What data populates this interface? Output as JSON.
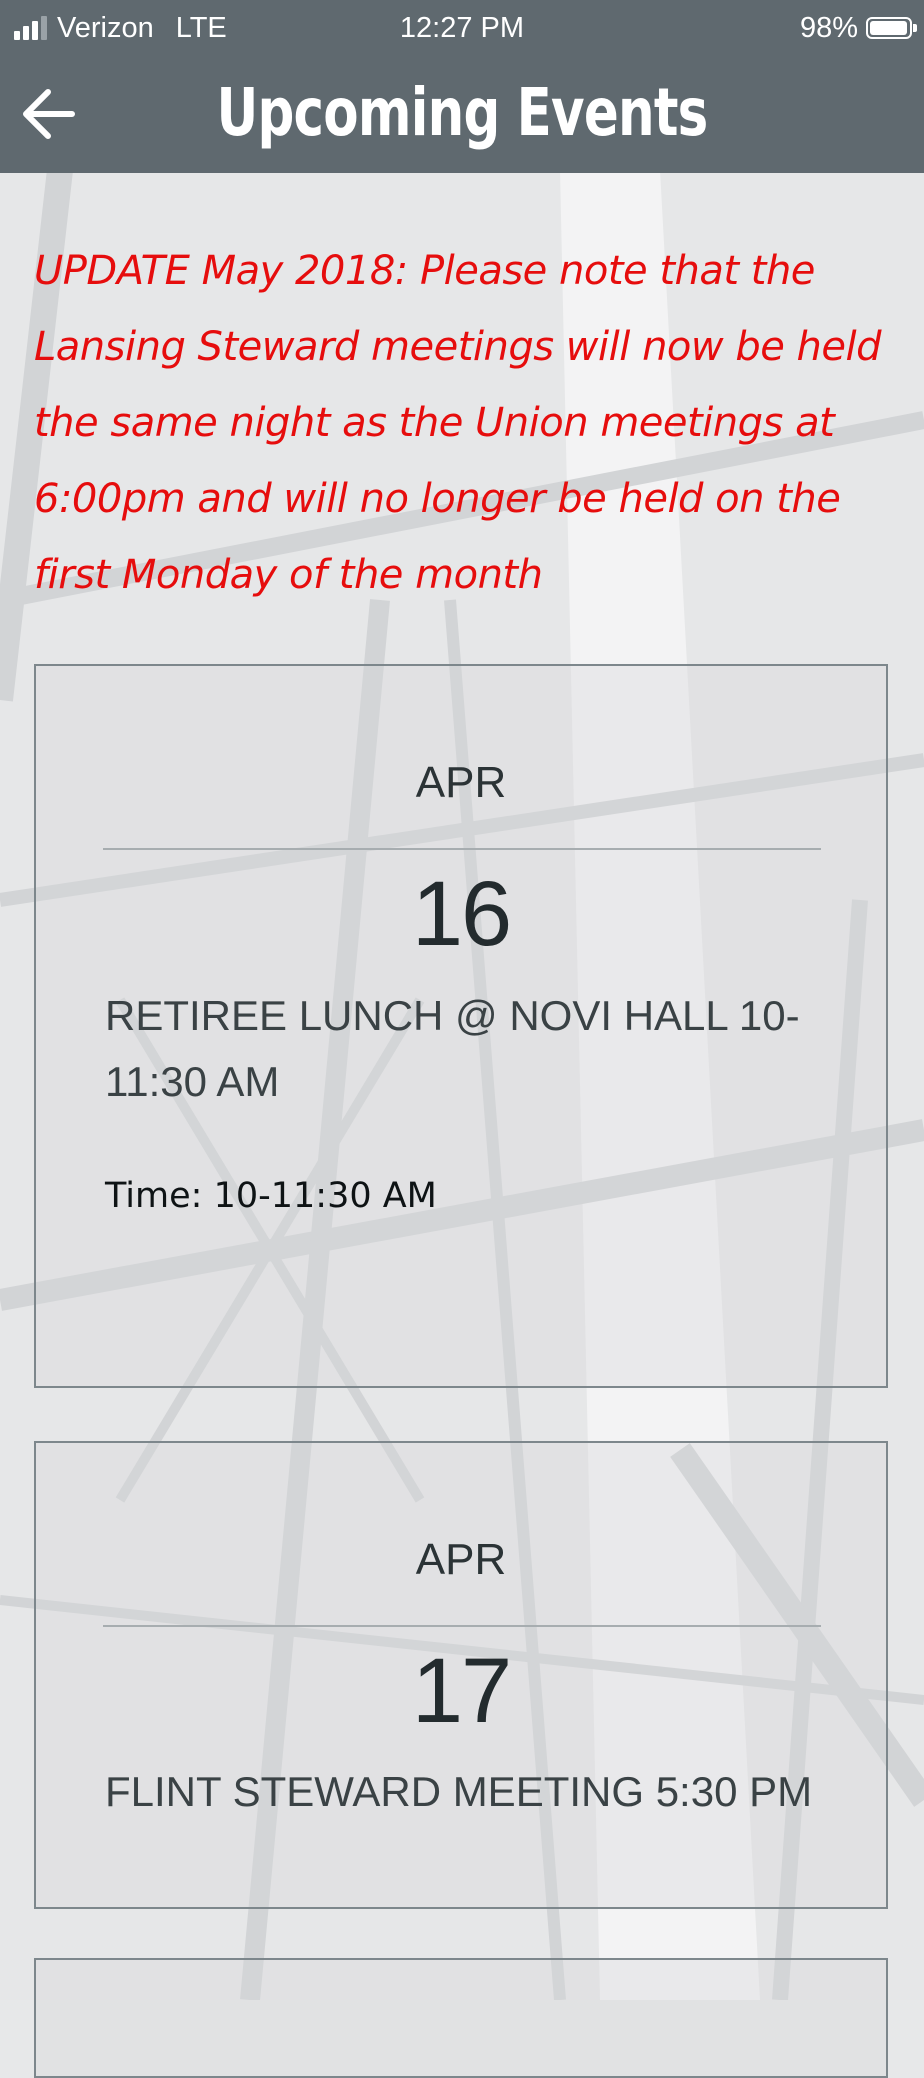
{
  "status_bar": {
    "carrier": "Verizon",
    "network": "LTE",
    "time": "12:27 PM",
    "battery": "98%",
    "battery_level": 0.98
  },
  "nav": {
    "title": "Upcoming Events",
    "back_icon": "arrow-left-icon"
  },
  "notice": {
    "text": "UPDATE May 2018: Please note that the Lansing Steward meetings will now be held the same night as the Union meetings at 6:00pm and will no longer be held on the first Monday of the month",
    "color": "#e60d0d"
  },
  "events": [
    {
      "month": "APR",
      "day": "16",
      "title": "RETIREE LUNCH @ NOVI HALL 10-11:30 AM",
      "time": "Time: 10-11:30 AM"
    },
    {
      "month": "APR",
      "day": "17",
      "title": "FLINT STEWARD MEETING 5:30 PM"
    }
  ],
  "colors": {
    "header_bg": "#5f696f",
    "card_border": "#7d878c"
  }
}
